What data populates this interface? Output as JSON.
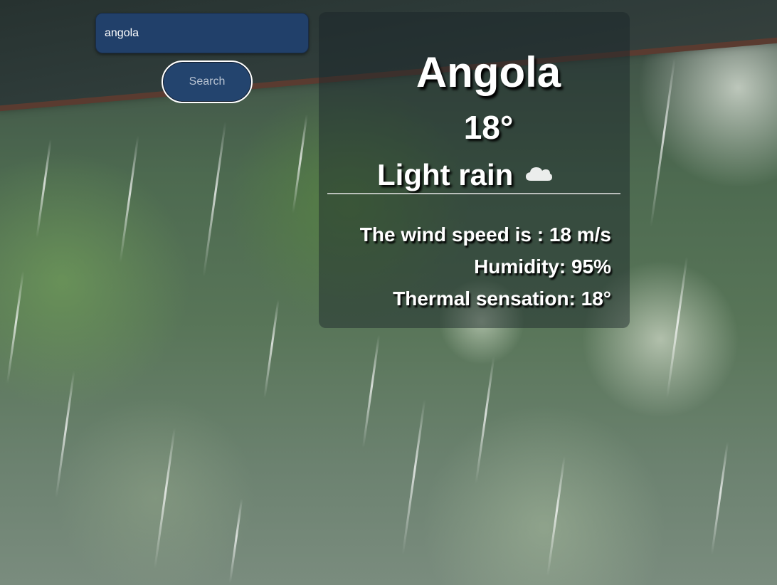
{
  "search": {
    "value": "angola",
    "placeholder": "",
    "button_label": "Search"
  },
  "weather": {
    "city": "Angola",
    "temperature": "18°",
    "description": "Light rain",
    "condition_icon": "cloud-icon",
    "wind": "The wind speed is : 18 m/s",
    "humidity": "Humidity: 95%",
    "thermal": "Thermal sensation: 18°"
  },
  "colors": {
    "input_bg": "#21406a",
    "button_bg": "#23446e",
    "text": "#ffffff"
  }
}
